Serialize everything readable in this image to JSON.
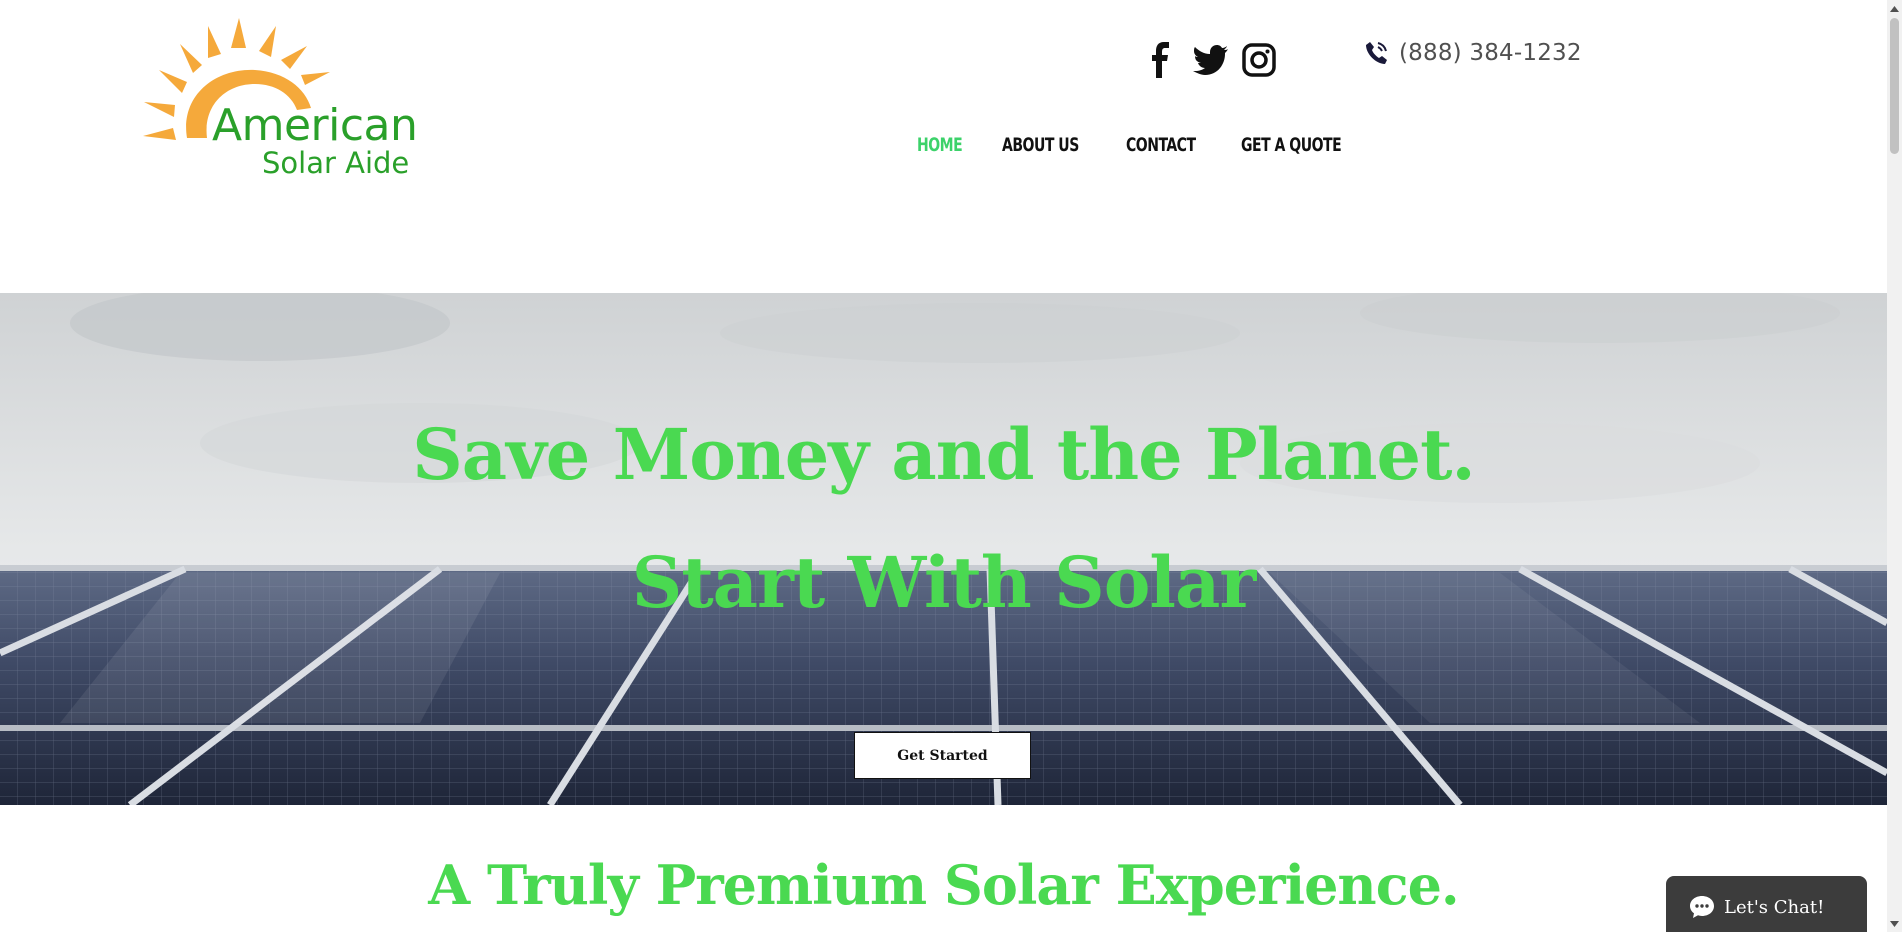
{
  "brand": {
    "line1": "American",
    "line2": "Solar Aide",
    "sun_color": "#f5a93b",
    "text_color": "#2aa02a"
  },
  "social": [
    {
      "icon": "facebook-icon"
    },
    {
      "icon": "twitter-icon"
    },
    {
      "icon": "instagram-icon"
    }
  ],
  "contact": {
    "phone_icon": "phone-icon",
    "phone": "(888) 384-1232"
  },
  "nav": {
    "items": [
      {
        "label": "HOME",
        "active": true
      },
      {
        "label": "ABOUT US",
        "active": false
      },
      {
        "label": "CONTACT",
        "active": false
      },
      {
        "label": "GET A QUOTE",
        "active": false
      }
    ],
    "active_color": "#3cd26a"
  },
  "hero": {
    "line1": "Save Money and the Planet.",
    "line2": "Start With Solar",
    "cta_label": "Get Started",
    "headline_color": "#4ad951"
  },
  "section": {
    "title": "A Truly Premium Solar Experience."
  },
  "chat": {
    "icon": "chat-bubble-icon",
    "label": "Let's Chat!"
  }
}
